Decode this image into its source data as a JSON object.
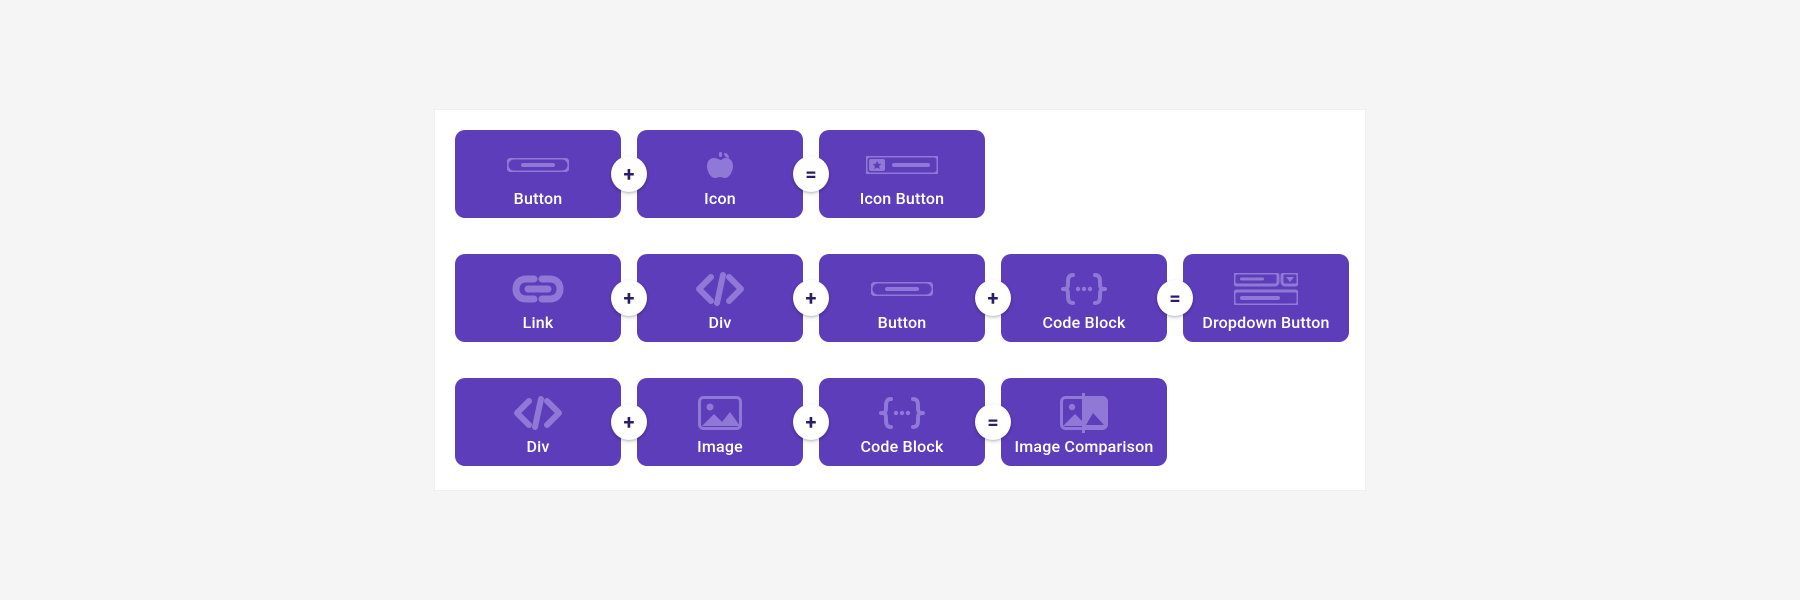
{
  "colors": {
    "tile": "#5e3dba",
    "tile_accent": "#8f78d6",
    "panel": "#ffffff",
    "page_bg": "#f5f5f5",
    "operator_text": "#2b1d66"
  },
  "operators": {
    "plus": "+",
    "equals": "="
  },
  "rows": [
    {
      "parts": [
        {
          "type": "tile",
          "label": "Button",
          "icon": "button"
        },
        {
          "type": "op",
          "value": "plus"
        },
        {
          "type": "tile",
          "label": "Icon",
          "icon": "apple"
        },
        {
          "type": "op",
          "value": "equals"
        },
        {
          "type": "tile",
          "label": "Icon Button",
          "icon": "icon-button"
        }
      ]
    },
    {
      "parts": [
        {
          "type": "tile",
          "label": "Link",
          "icon": "link"
        },
        {
          "type": "op",
          "value": "plus"
        },
        {
          "type": "tile",
          "label": "Div",
          "icon": "div"
        },
        {
          "type": "op",
          "value": "plus"
        },
        {
          "type": "tile",
          "label": "Button",
          "icon": "button"
        },
        {
          "type": "op",
          "value": "plus"
        },
        {
          "type": "tile",
          "label": "Code Block",
          "icon": "code-block"
        },
        {
          "type": "op",
          "value": "equals"
        },
        {
          "type": "tile",
          "label": "Dropdown Button",
          "icon": "dropdown-button"
        }
      ]
    },
    {
      "parts": [
        {
          "type": "tile",
          "label": "Div",
          "icon": "div"
        },
        {
          "type": "op",
          "value": "plus"
        },
        {
          "type": "tile",
          "label": "Image",
          "icon": "image"
        },
        {
          "type": "op",
          "value": "plus"
        },
        {
          "type": "tile",
          "label": "Code Block",
          "icon": "code-block"
        },
        {
          "type": "op",
          "value": "equals"
        },
        {
          "type": "tile",
          "label": "Image Comparison",
          "icon": "image-comparison"
        }
      ]
    }
  ]
}
